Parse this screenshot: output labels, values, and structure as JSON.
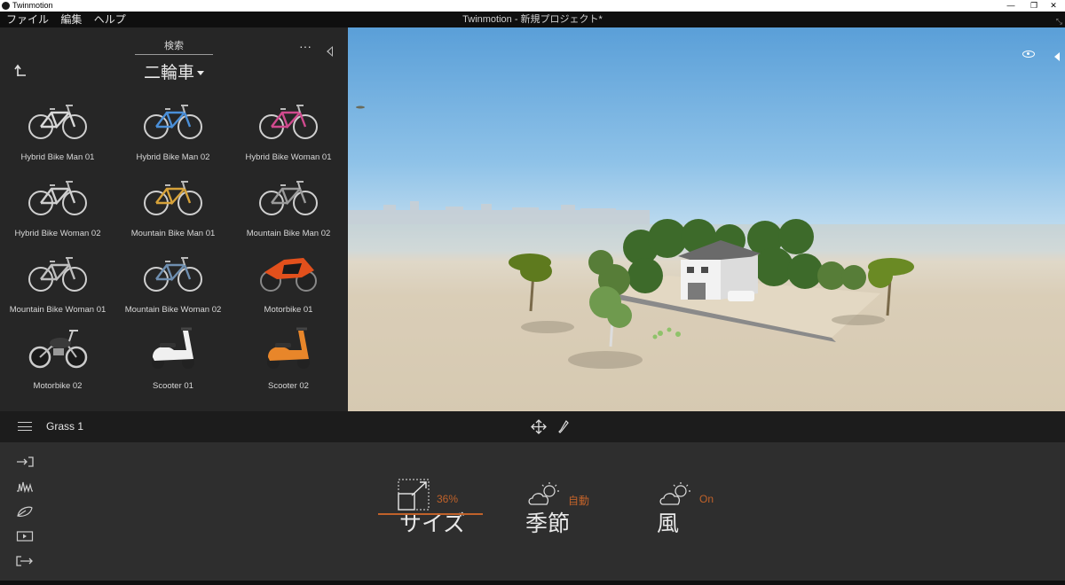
{
  "window": {
    "app_name": "Twinmotion",
    "title": "Twinmotion - 新規プロジェクト*",
    "minimize": "—",
    "maximize": "❐",
    "close": "✕"
  },
  "menu": {
    "items": [
      "ファイル",
      "編集",
      "ヘルプ"
    ]
  },
  "library": {
    "search_label": "検索",
    "more_label": "···",
    "category": "二輪車",
    "items": [
      {
        "label": "Hybrid Bike Man 01",
        "kind": "bicycle",
        "color": "#d9d9d9"
      },
      {
        "label": "Hybrid Bike Man 02",
        "kind": "bicycle",
        "color": "#4a8fd8"
      },
      {
        "label": "Hybrid Bike Woman 01",
        "kind": "bicycle",
        "color": "#d04a8e"
      },
      {
        "label": "Hybrid Bike Woman 02",
        "kind": "bicycle",
        "color": "#cfcfcf"
      },
      {
        "label": "Mountain Bike Man 01",
        "kind": "bicycle",
        "color": "#d6a23a"
      },
      {
        "label": "Mountain Bike Man 02",
        "kind": "bicycle",
        "color": "#9a9a9a"
      },
      {
        "label": "Mountain Bike Woman 01",
        "kind": "bicycle",
        "color": "#bdbdbd"
      },
      {
        "label": "Mountain Bike Woman 02",
        "kind": "bicycle",
        "color": "#6f8fb0"
      },
      {
        "label": "Motorbike 01",
        "kind": "sportbike",
        "color": "#e2501c"
      },
      {
        "label": "Motorbike 02",
        "kind": "cruiser",
        "color": "#3a3a3a"
      },
      {
        "label": "Scooter 01",
        "kind": "scooter",
        "color": "#f0f0f0"
      },
      {
        "label": "Scooter 02",
        "kind": "scooter",
        "color": "#e8862a"
      }
    ]
  },
  "toolbar": {
    "selected_object": "Grass 1"
  },
  "properties": {
    "size": {
      "label": "サイズ",
      "value": "36%"
    },
    "season": {
      "label": "季節",
      "value": "自動"
    },
    "wind": {
      "label": "風",
      "value": "On"
    }
  },
  "colors": {
    "accent": "#c0622a",
    "panel": "#262626",
    "toolbar": "#1c1c1c",
    "props": "#2e2e2e"
  }
}
